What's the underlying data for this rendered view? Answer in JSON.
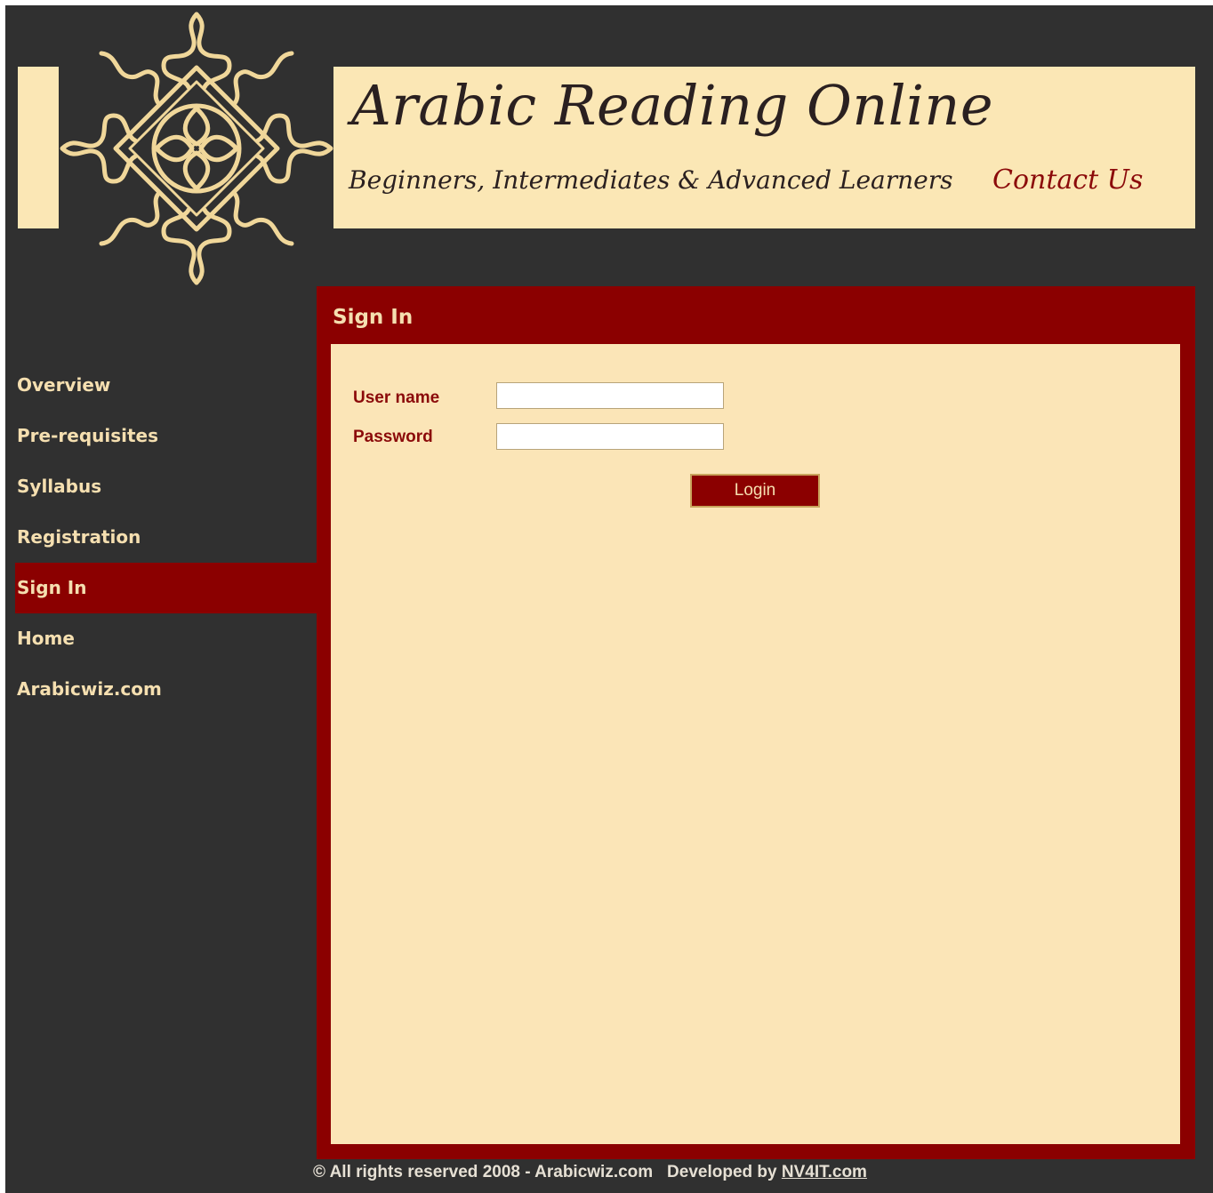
{
  "header": {
    "title": "Arabic Reading Online",
    "tagline": "Beginners, Intermediates & Advanced Learners",
    "contact_label": "Contact Us"
  },
  "logo": {
    "icon": "ornamental-star-logo",
    "color": "#f0d79a"
  },
  "nav": {
    "items": [
      {
        "label": "Overview"
      },
      {
        "label": "Pre-requisites"
      },
      {
        "label": "Syllabus"
      },
      {
        "label": "Registration"
      },
      {
        "label": "Sign In",
        "active": true
      },
      {
        "label": "Home"
      },
      {
        "label": "Arabicwiz.com"
      }
    ]
  },
  "signin": {
    "title": "Sign In",
    "username_label": "User name",
    "username_value": "",
    "password_label": "Password",
    "password_value": "",
    "login_label": "Login"
  },
  "footer": {
    "copyright": "© All rights reserved 2008 - Arabicwiz.com",
    "developed_by": "Developed by",
    "developer_link": "NV4IT.com"
  },
  "colors": {
    "background": "#303030",
    "cream": "#fbe5b7",
    "accent": "#8b0000",
    "nav_text": "#f5dfb0"
  }
}
